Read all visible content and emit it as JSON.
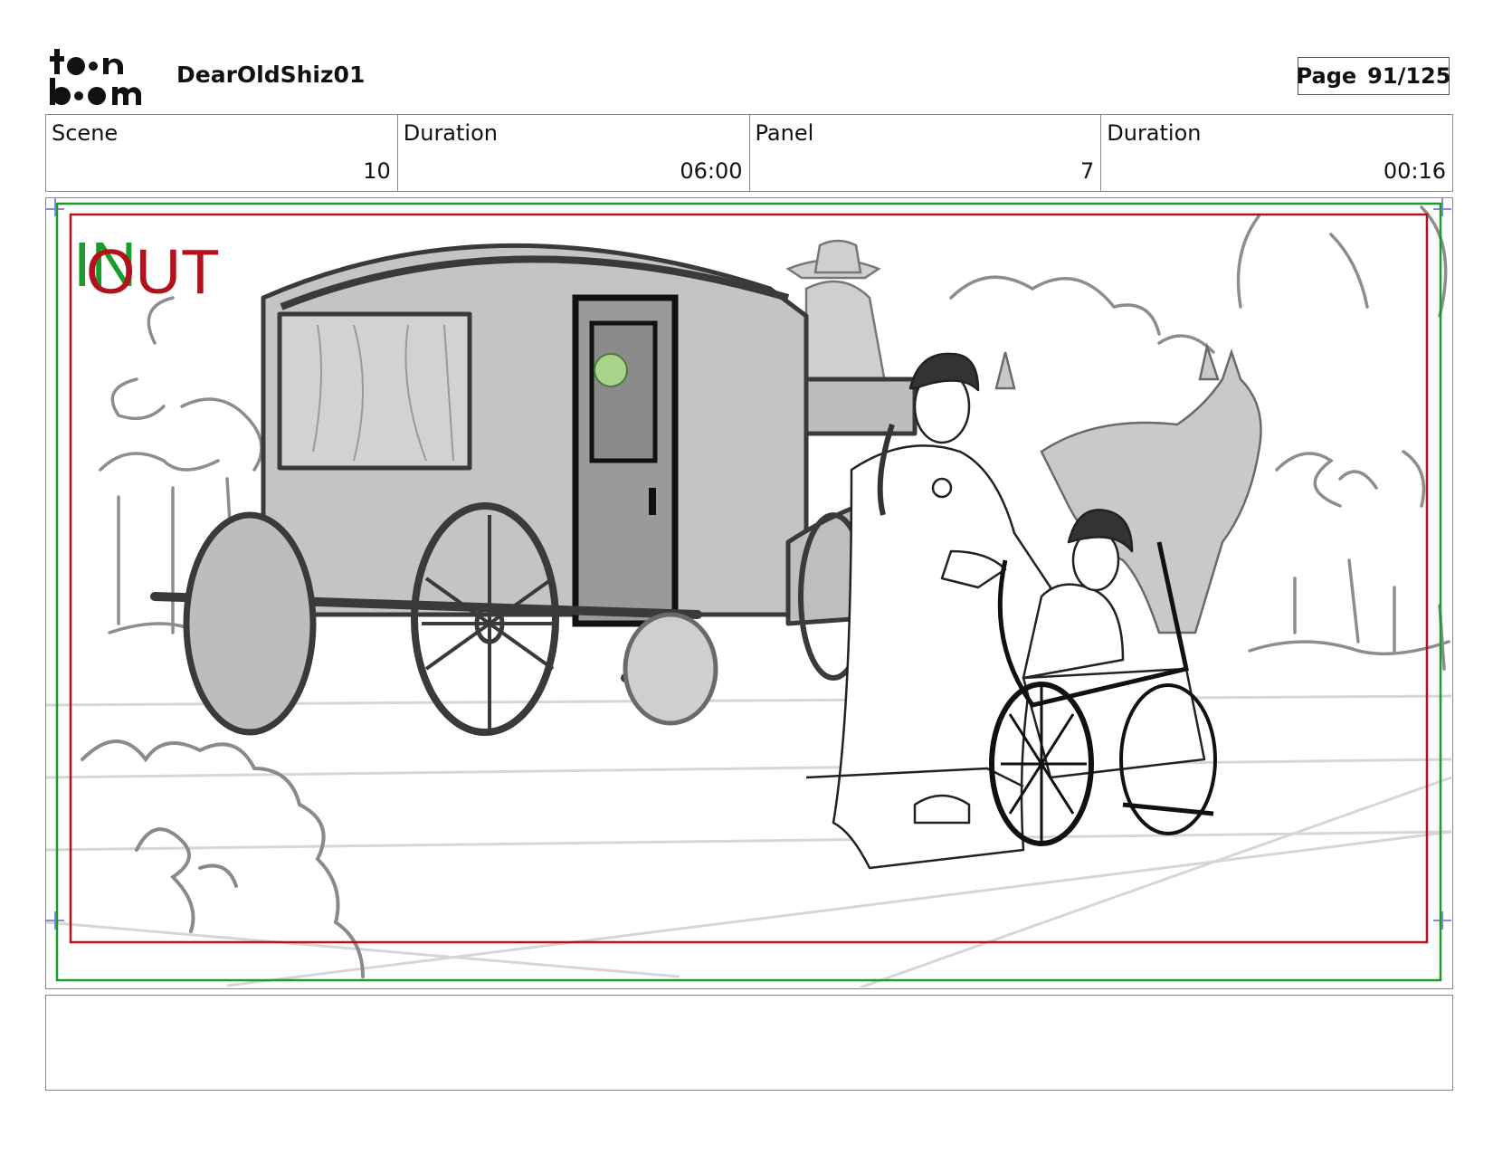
{
  "header": {
    "logo_icon": "toon-boom-logo",
    "project_title": "DearOldShiz01",
    "page_label": "Page",
    "page_value": "91/125"
  },
  "info": {
    "scene_label": "Scene",
    "scene_value": "10",
    "scene_duration_label": "Duration",
    "scene_duration_value": "06:00",
    "panel_label": "Panel",
    "panel_value": "7",
    "panel_duration_label": "Duration",
    "panel_duration_value": "00:16"
  },
  "panel": {
    "in_marker": "IN",
    "out_marker": "OUT",
    "safe_frame_color": "#1a9c2a",
    "action_frame_color": "#b3121c"
  },
  "notes": {
    "text": ""
  }
}
